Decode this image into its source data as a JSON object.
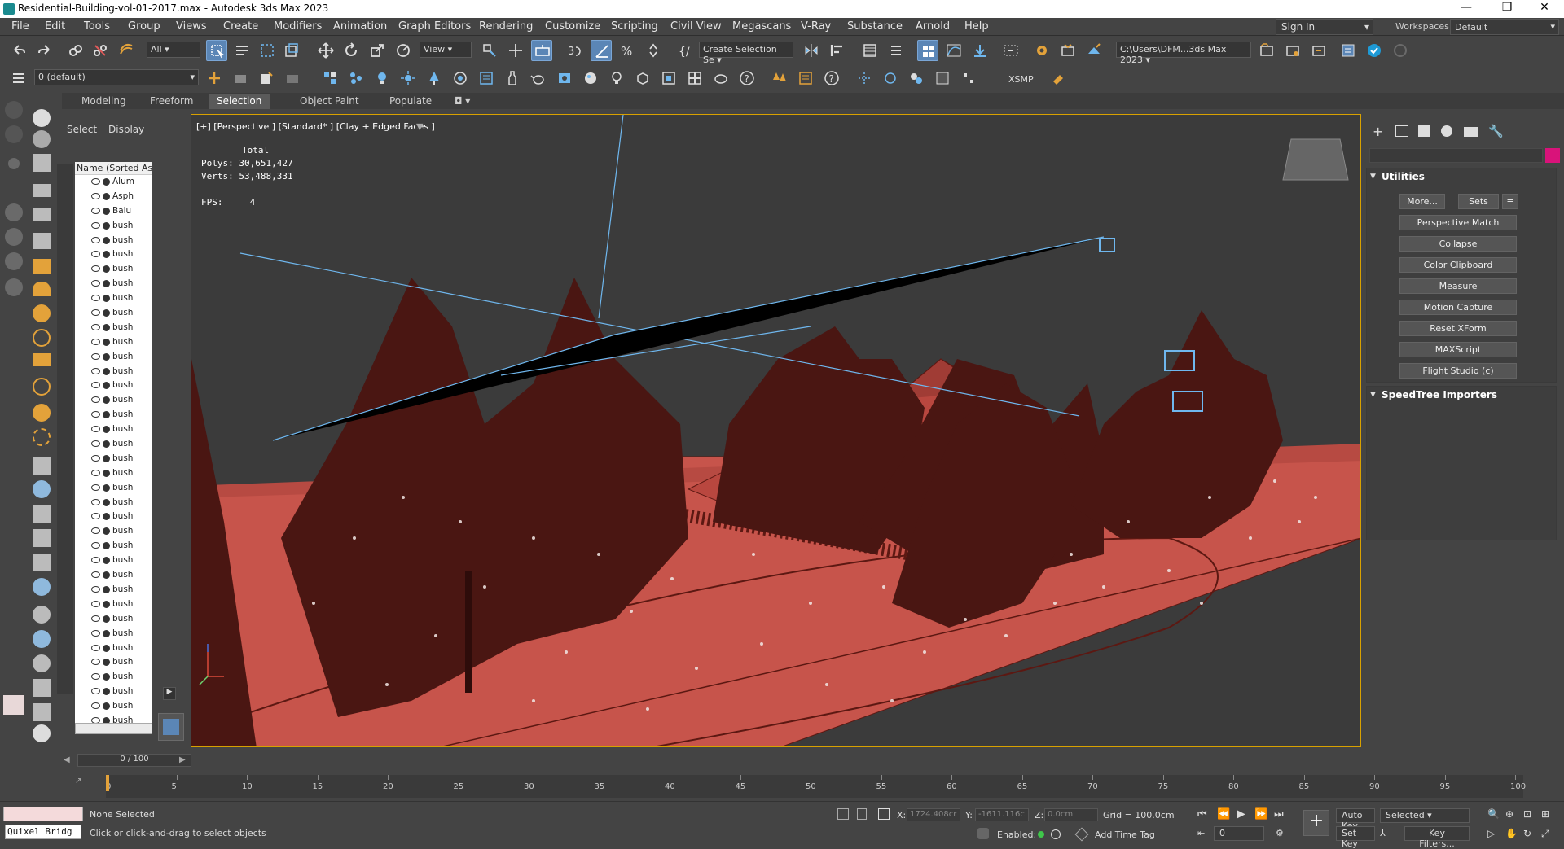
{
  "window": {
    "title": "Residential-Building-vol-01-2017.max - Autodesk 3ds Max 2023",
    "minimize": "—",
    "restore": "❐",
    "close": "✕"
  },
  "menu": [
    "File",
    "Edit",
    "Tools",
    "Group",
    "Views",
    "Create",
    "Modifiers",
    "Animation",
    "Graph Editors",
    "Rendering",
    "Customize",
    "Scripting",
    "Civil View",
    "Megascans",
    "V-Ray",
    "Substance",
    "Arnold",
    "Help"
  ],
  "signin": "Sign In",
  "workspace": {
    "label": "Workspaces:",
    "value": "Default"
  },
  "toolbar": {
    "filter": "All",
    "refcoord": "View",
    "selset": "Create Selection Se",
    "path": "C:\\Users\\DFM...3ds Max 2023",
    "layer": "0 (default)",
    "xsmp": "XSMP"
  },
  "ribbon": [
    "Modeling",
    "Freeform",
    "Selection",
    "Object Paint",
    "Populate"
  ],
  "ribbon_active": "Selection",
  "explorer": {
    "tabs": [
      "Select",
      "Display"
    ],
    "header": "Name (Sorted Ascending)",
    "items": [
      "Alum",
      "Asph",
      "Balu",
      "bush",
      "bush",
      "bush",
      "bush",
      "bush",
      "bush",
      "bush",
      "bush",
      "bush",
      "bush",
      "bush",
      "bush",
      "bush",
      "bush",
      "bush",
      "bush",
      "bush",
      "bush",
      "bush",
      "bush",
      "bush",
      "bush",
      "bush",
      "bush",
      "bush",
      "bush",
      "bush",
      "bush",
      "bush",
      "bush",
      "bush",
      "bush",
      "bush",
      "bush",
      "bush"
    ]
  },
  "viewport": {
    "label": "[+] [Perspective ] [Standard* ] [Clay + Edged Faces ]",
    "stats": {
      "total_label": "Total",
      "polys_label": "Polys:",
      "polys": "30,651,427",
      "verts_label": "Verts:",
      "verts": "53,488,331",
      "fps_label": "FPS:",
      "fps": "4"
    },
    "colors": {
      "ground": "#c7544b",
      "trees": "#4a1612",
      "house": "#b9473f",
      "bg": "#3b3b3b",
      "wire": "#6fb7ee"
    }
  },
  "command_panel": {
    "rollout": "Utilities",
    "buttons": [
      "More...",
      "Sets",
      "Perspective Match",
      "Collapse",
      "Color Clipboard",
      "Measure",
      "Motion Capture",
      "Reset XForm",
      "MAXScript",
      "Flight Studio (c)"
    ],
    "rollout2": "SpeedTree Importers"
  },
  "timeline": {
    "counter": "0 / 100",
    "ticks": [
      "0",
      "5",
      "10",
      "15",
      "20",
      "25",
      "30",
      "35",
      "40",
      "45",
      "50",
      "55",
      "60",
      "65",
      "70",
      "75",
      "80",
      "85",
      "90",
      "95",
      "100"
    ]
  },
  "status": {
    "selection": "None Selected",
    "prompt": "Click or click-and-drag to select objects",
    "quixel": "Quixel Bridg",
    "x_label": "X:",
    "x": "1724.408cr",
    "y_label": "Y:",
    "y": "-1611.116c",
    "z_label": "Z:",
    "z": "0.0cm",
    "grid": "Grid = 100.0cm",
    "enabled": "Enabled:",
    "add_time_tag": "Add Time Tag",
    "auto_key": "Auto Key",
    "selected": "Selected",
    "set_key": "Set Key",
    "key_filters": "Key Filters...",
    "frame": "0"
  }
}
